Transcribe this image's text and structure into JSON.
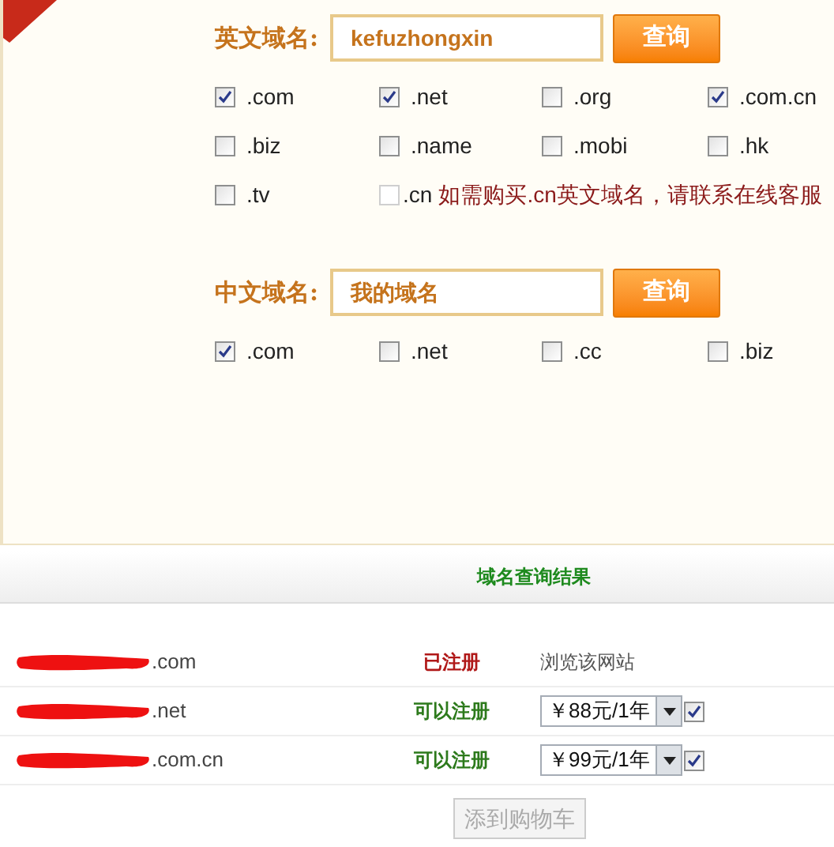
{
  "english_search": {
    "label": "英文域名:",
    "value": "kefuzhongxin",
    "button": "查询",
    "options": [
      {
        "label": ".com",
        "checked": true,
        "disabled": false
      },
      {
        "label": ".net",
        "checked": true,
        "disabled": false
      },
      {
        "label": ".org",
        "checked": false,
        "disabled": false
      },
      {
        "label": ".com.cn",
        "checked": true,
        "disabled": false
      },
      {
        "label": ".biz",
        "checked": false,
        "disabled": false
      },
      {
        "label": ".name",
        "checked": false,
        "disabled": false
      },
      {
        "label": ".mobi",
        "checked": false,
        "disabled": false
      },
      {
        "label": ".hk",
        "checked": false,
        "disabled": false
      },
      {
        "label": ".tv",
        "checked": false,
        "disabled": false
      },
      {
        "label": ".cn",
        "checked": false,
        "disabled": true,
        "note": "如需购买.cn英文域名，请联系在线客服"
      }
    ]
  },
  "chinese_search": {
    "label": "中文域名:",
    "value": "我的域名",
    "button": "查询",
    "options": [
      {
        "label": ".com",
        "checked": true,
        "disabled": false
      },
      {
        "label": ".net",
        "checked": false,
        "disabled": false
      },
      {
        "label": ".cc",
        "checked": false,
        "disabled": false
      },
      {
        "label": ".biz",
        "checked": false,
        "disabled": false
      }
    ]
  },
  "results": {
    "title": "域名查询结果",
    "rows": [
      {
        "domain": ".com",
        "status": "已注册",
        "kind": "registered",
        "action": {
          "kind": "link",
          "text": "浏览该网站"
        }
      },
      {
        "domain": ".net",
        "status": "可以注册",
        "kind": "available",
        "action": {
          "kind": "price",
          "value": "￥88元/1年",
          "checked": true
        }
      },
      {
        "domain": ".com.cn",
        "status": "可以注册",
        "kind": "available",
        "action": {
          "kind": "price",
          "value": "￥99元/1年",
          "checked": true
        }
      }
    ],
    "button": {
      "label": "添到购物车",
      "disabled": true
    }
  }
}
